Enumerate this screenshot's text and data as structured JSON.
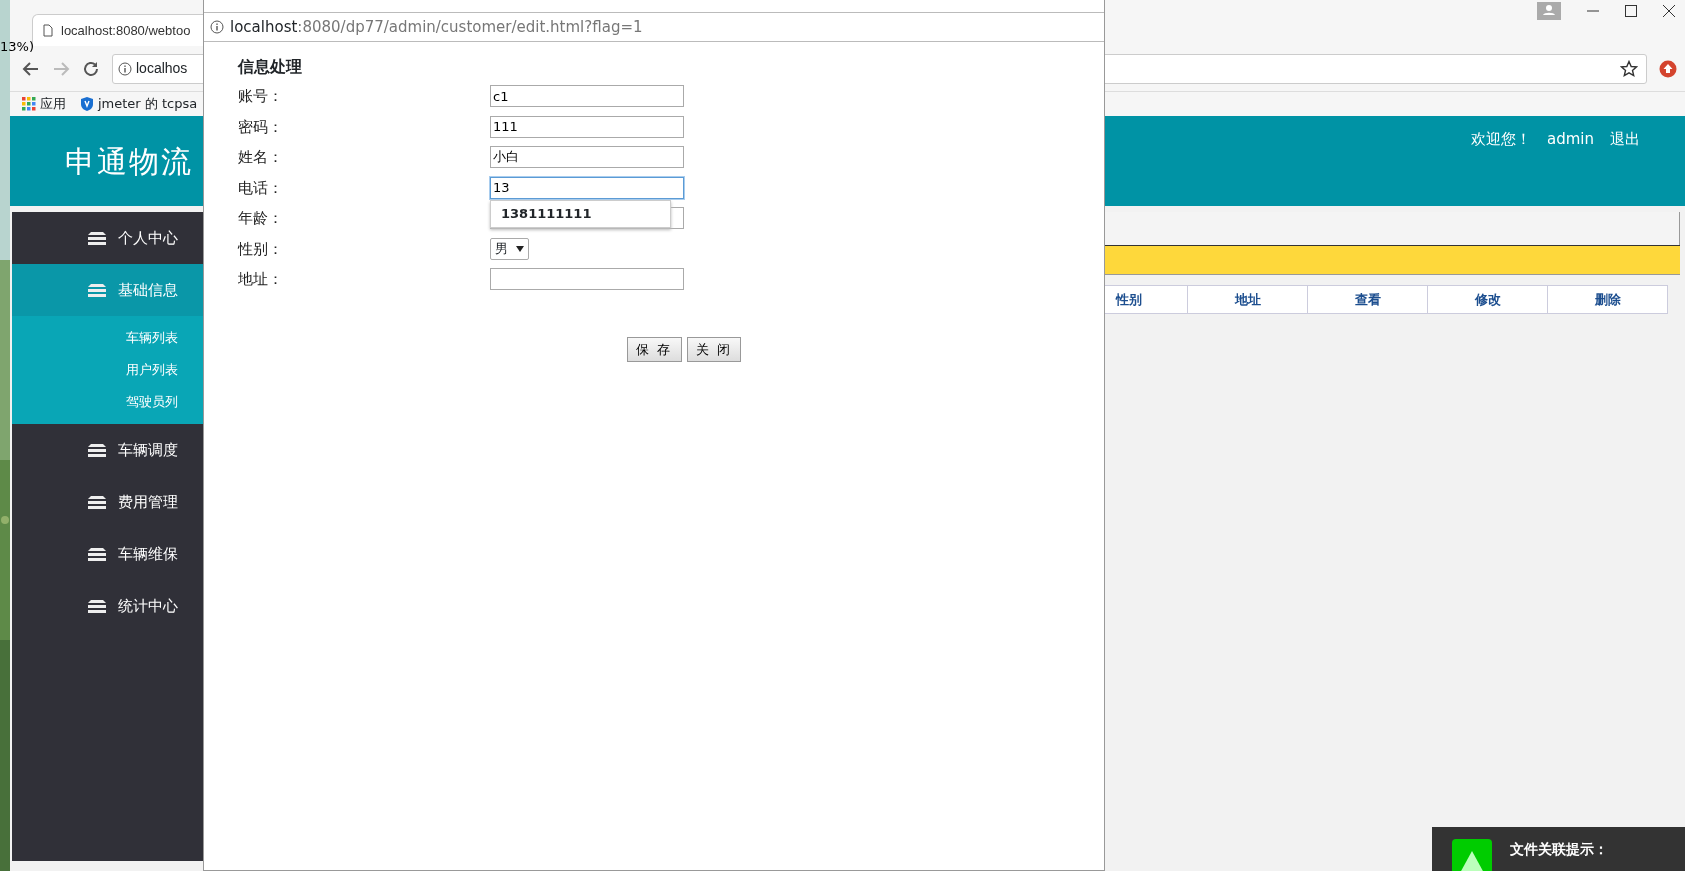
{
  "browser": {
    "tab_title": "localhost:8080/webtoo",
    "zoom_note": "13%)",
    "address": "localhos",
    "bookmarks": [
      {
        "label": "应用",
        "kind": "apps"
      },
      {
        "label": "jmeter 的 tcpsa",
        "kind": "shield"
      }
    ]
  },
  "header": {
    "title": "申通物流",
    "welcome": "欢迎您！",
    "user": "admin",
    "logout": "退出"
  },
  "sidebar": {
    "items": [
      {
        "label": "个人中心",
        "selected": false
      },
      {
        "label": "基础信息",
        "selected": true,
        "children": [
          {
            "label": "车辆列表"
          },
          {
            "label": "用户列表"
          },
          {
            "label": "驾驶员列"
          }
        ]
      },
      {
        "label": "车辆调度",
        "selected": false
      },
      {
        "label": "费用管理",
        "selected": false
      },
      {
        "label": "车辆维保",
        "selected": false
      },
      {
        "label": "统计中心",
        "selected": false
      }
    ]
  },
  "table": {
    "columns": [
      "性别",
      "地址",
      "查看",
      "修改",
      "删除"
    ]
  },
  "popup": {
    "url_host": "localhost",
    "url_rest": ":8080/dp77/admin/customer/edit.html?flag=1",
    "form": {
      "title": "信息处理",
      "fields": [
        {
          "label": "账号：",
          "kind": "text",
          "value": "c1",
          "focused": false
        },
        {
          "label": "密码：",
          "kind": "text",
          "value": "111",
          "focused": false
        },
        {
          "label": "姓名：",
          "kind": "text",
          "value": "小白",
          "focused": false
        },
        {
          "label": "电话：",
          "kind": "text",
          "value": "13",
          "focused": true,
          "suggestion": "1381111111"
        },
        {
          "label": "年龄：",
          "kind": "text",
          "focused": false
        },
        {
          "label": "性别：",
          "kind": "select",
          "value": "男",
          "focused": false
        },
        {
          "label": "地址：",
          "kind": "text",
          "focused": false
        }
      ],
      "buttons": [
        "保 存",
        "关 闭"
      ]
    }
  },
  "notification": {
    "title": "文件关联提示："
  }
}
